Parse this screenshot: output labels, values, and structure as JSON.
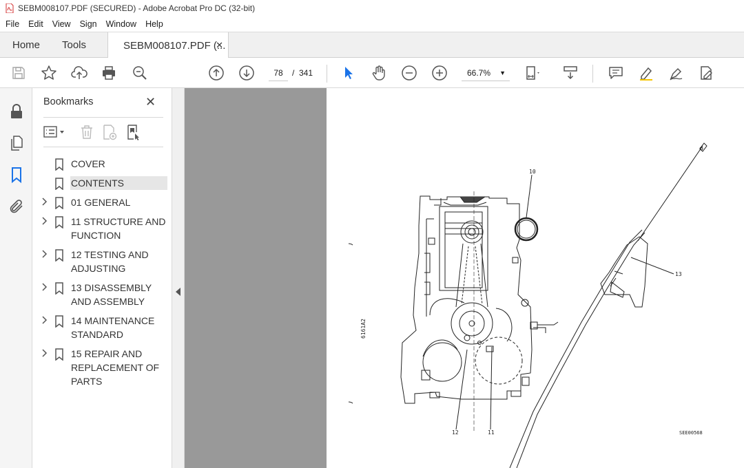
{
  "window": {
    "title": "SEBM008107.PDF (SECURED) - Adobe Acrobat Pro DC (32-bit)"
  },
  "menubar": [
    "File",
    "Edit",
    "View",
    "Sign",
    "Window",
    "Help"
  ],
  "tabs": {
    "home": "Home",
    "tools": "Tools",
    "document": "SEBM008107.PDF (..."
  },
  "toolbar": {
    "current_page": "78",
    "page_separator": "/",
    "total_pages": "341",
    "zoom": "66.7%",
    "icons": [
      "save-icon",
      "star-icon",
      "upload-icon",
      "print-icon",
      "zoom-search-icon",
      "page-up-icon",
      "page-down-icon",
      "select-arrow-icon",
      "hand-icon",
      "zoom-out-icon",
      "zoom-in-icon",
      "page-fit-icon",
      "scroll-mode-icon",
      "comment-icon",
      "highlight-icon",
      "sign-icon",
      "edit-pdf-icon"
    ]
  },
  "bookmarks": {
    "title": "Bookmarks",
    "items": [
      {
        "label": "COVER",
        "expandable": false
      },
      {
        "label": "CONTENTS",
        "expandable": false,
        "selected": true
      },
      {
        "label": "01 GENERAL",
        "expandable": true
      },
      {
        "label": "11 STRUCTURE AND FUNCTION",
        "expandable": true
      },
      {
        "label": "12 TESTING AND ADJUSTING",
        "expandable": true
      },
      {
        "label": "13 DISASSEMBLY AND ASSEMBLY",
        "expandable": true
      },
      {
        "label": "14 MAINTENANCE STANDARD",
        "expandable": true
      },
      {
        "label": "15 REPAIR AND REPLACEMENT OF PARTS",
        "expandable": true
      }
    ]
  },
  "page_drawing": {
    "callouts": [
      "10",
      "13",
      "12",
      "11"
    ],
    "side_code": "6161A2",
    "figure_code": "SEE00568"
  },
  "colors": {
    "accent": "#1a73e8",
    "doc_background": "#999999",
    "selected_bookmark": "#e6e6e6",
    "pdf_icon_red": "#d32f2f"
  }
}
